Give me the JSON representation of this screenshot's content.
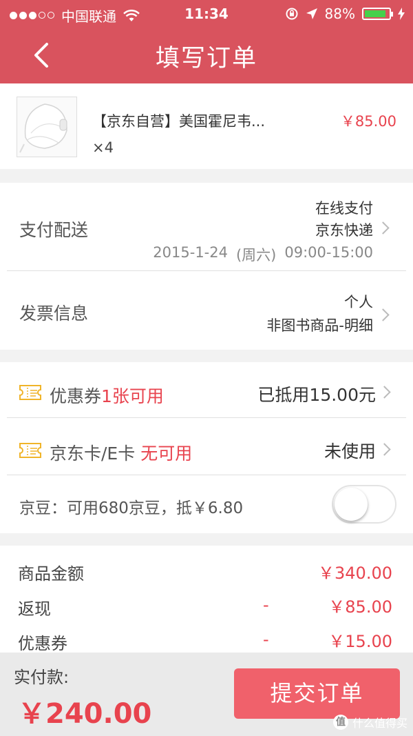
{
  "status_bar": {
    "carrier": "中国联通",
    "time": "11:34",
    "battery_percent": "88%",
    "battery_level": 0.88,
    "icons": [
      "signal-dots-icon",
      "wifi-icon",
      "rotation-lock-icon",
      "location-arrow-icon",
      "battery-icon",
      "charging-bolt-icon"
    ]
  },
  "header": {
    "title": "填写订单",
    "back_icon": "chevron-left-icon"
  },
  "product": {
    "name": "【京东自营】美国霍尼韦...",
    "price": "￥85.00",
    "quantity": "×4",
    "image_icon": "face-mask-image"
  },
  "payment": {
    "label": "支付配送",
    "method": "在线支付",
    "delivery": "京东快递",
    "date": "2015-1-24",
    "weekday": "(周六)",
    "time_window": "09:00-15:00"
  },
  "invoice": {
    "label": "发票信息",
    "type": "个人",
    "content": "非图书商品-明细"
  },
  "coupon": {
    "label": "优惠券",
    "available": "1张可用",
    "value": "已抵用15.00元",
    "icon": "ticket-icon"
  },
  "jdcard": {
    "label": "京东卡/E卡",
    "available": "无可用",
    "value": "未使用",
    "icon": "ticket-icon"
  },
  "beans": {
    "text": "京豆：可用680京豆，抵￥6.80",
    "enabled": false
  },
  "summary": {
    "rows": [
      {
        "label": "商品金额",
        "sign": "",
        "amount": "￥340.00"
      },
      {
        "label": "返现",
        "sign": "-",
        "amount": "￥85.00"
      },
      {
        "label": "优惠券",
        "sign": "-",
        "amount": "￥15.00"
      }
    ]
  },
  "footer": {
    "total_label": "实付款:",
    "total": "￥240.00",
    "submit_label": "提交订单",
    "watermark": "什么值得买",
    "watermark_badge": "值"
  },
  "colors": {
    "header": "#d9535e",
    "accent_red": "#e8434e",
    "button": "#f0616b",
    "ticket_icon": "#f0b429",
    "battery_fill": "#45d04b"
  }
}
